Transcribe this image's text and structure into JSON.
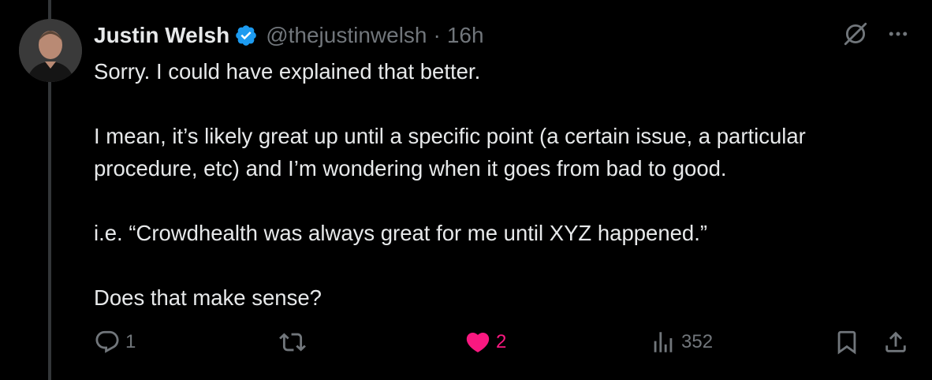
{
  "tweet": {
    "author_name": "Justin Welsh",
    "handle": "@thejustinwelsh",
    "separator": "·",
    "time": "16h",
    "paragraphs": [
      "Sorry. I could have explained that better.",
      "I mean, it’s likely great up until a specific point (a certain issue, a particular procedure, etc) and I’m wondering when it goes from bad to good.",
      "i.e. “Crowdhealth was always great for me until XYZ happened.”",
      "Does that make sense?"
    ]
  },
  "actions": {
    "reply_count": "1",
    "repost_count": "",
    "like_count": "2",
    "views_count": "352"
  },
  "icons": {
    "verified": "verified-badge-icon",
    "grok": "grok-icon",
    "more": "more-icon",
    "reply": "reply-icon",
    "repost": "repost-icon",
    "like": "heart-icon",
    "views": "views-icon",
    "bookmark": "bookmark-icon",
    "share": "share-icon"
  },
  "colors": {
    "background": "#000000",
    "text": "#e7e9ea",
    "muted": "#71767b",
    "verified": "#1d9bf0",
    "like": "#f91880",
    "thread_line": "#333639"
  }
}
